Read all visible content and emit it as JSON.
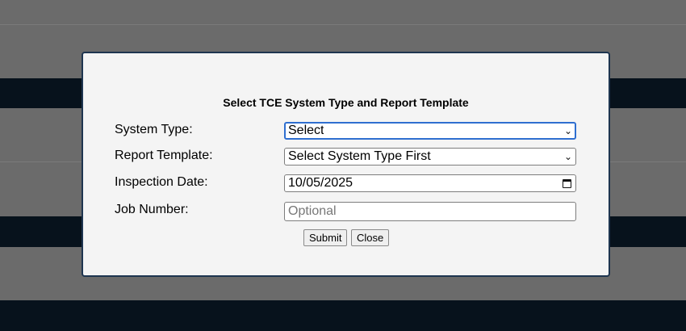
{
  "dialog": {
    "title": "Select TCE System Type and Report Template",
    "fields": [
      {
        "label": "System Type:",
        "value": "Select",
        "icon": "chevron-down-icon"
      },
      {
        "label": "Report Template:",
        "value": "Select System Type First",
        "icon": "chevron-down-icon"
      },
      {
        "label": "Inspection Date:",
        "value": "10/05/2025",
        "icon": "calendar-icon"
      },
      {
        "label": "Job Number:",
        "value": "",
        "placeholder": "Optional"
      }
    ],
    "buttons": {
      "submit_label": "Submit",
      "close_label": "Close"
    }
  },
  "colors": {
    "backdrop": "#6b6b6b",
    "dark_band": "#07121c",
    "modal_border": "#1e3550",
    "focus_ring": "#2f6fd0"
  }
}
